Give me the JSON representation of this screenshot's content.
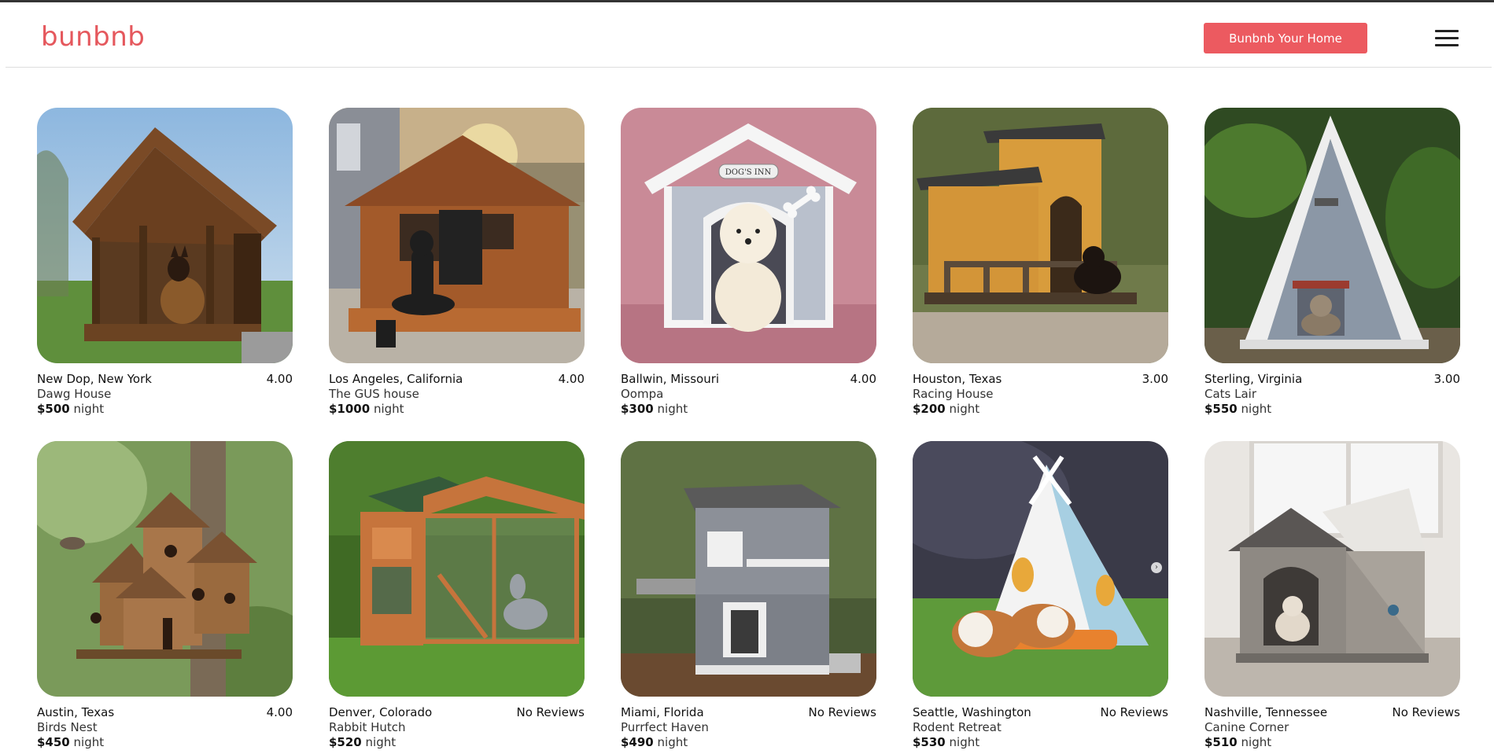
{
  "brand": {
    "name": "bunbnb",
    "color": "#e5585d"
  },
  "header": {
    "host_button_label": "Bunbnb Your Home",
    "menu_icon": "hamburger-icon"
  },
  "listings": [
    {
      "location": "New Dop, New York",
      "title": "Dawg House",
      "price": "$500",
      "unit": "night",
      "rating": "4.00"
    },
    {
      "location": "Los Angeles, California",
      "title": "The GUS house",
      "price": "$1000",
      "unit": "night",
      "rating": "4.00"
    },
    {
      "location": "Ballwin, Missouri",
      "title": "Oompa",
      "price": "$300",
      "unit": "night",
      "rating": "4.00",
      "sign": "DOG'S INN"
    },
    {
      "location": "Houston, Texas",
      "title": "Racing House",
      "price": "$200",
      "unit": "night",
      "rating": "3.00"
    },
    {
      "location": "Sterling, Virginia",
      "title": "Cats Lair",
      "price": "$550",
      "unit": "night",
      "rating": "3.00"
    },
    {
      "location": "Austin, Texas",
      "title": "Birds Nest",
      "price": "$450",
      "unit": "night",
      "rating": "4.00"
    },
    {
      "location": "Denver, Colorado",
      "title": "Rabbit Hutch",
      "price": "$520",
      "unit": "night",
      "rating": "No Reviews"
    },
    {
      "location": "Miami, Florida",
      "title": "Purrfect Haven",
      "price": "$490",
      "unit": "night",
      "rating": "No Reviews"
    },
    {
      "location": "Seattle, Washington",
      "title": "Rodent Retreat",
      "price": "$530",
      "unit": "night",
      "rating": "No Reviews",
      "carousel_icon": "chevron-right-icon"
    },
    {
      "location": "Nashville, Tennessee",
      "title": "Canine Corner",
      "price": "$510",
      "unit": "night",
      "rating": "No Reviews"
    }
  ]
}
